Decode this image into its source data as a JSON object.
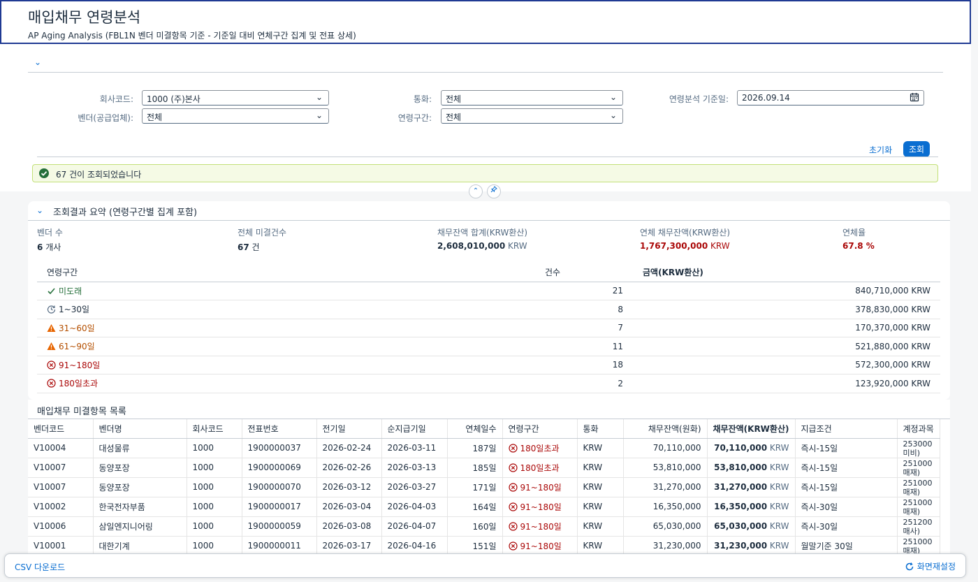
{
  "header": {
    "title": "매입채무 연령분석",
    "subtitle": "AP Aging Analysis (FBL1N 벤더 미결항목 기준 - 기준일 대비 연체구간 집계 및 전표 상세)"
  },
  "filters": {
    "company_label": "회사코드:",
    "company_value": "1000 (주)본사",
    "vendor_label": "벤더(공급업체):",
    "vendor_value": "전체",
    "currency_label": "통화:",
    "currency_value": "전체",
    "bucket_label": "연령구간:",
    "bucket_value": "전체",
    "date_label": "연령분석 기준일:",
    "date_value": "2026.09.14",
    "reset_label": "초기화",
    "search_label": "조회"
  },
  "message": "67 건이 조회되었습니다",
  "summary": {
    "title": "조회결과 요약 (연령구간별 집계 포함)",
    "kpis": {
      "vendor_count_label": "벤더 수",
      "vendor_count_value": "6",
      "vendor_count_unit": "개사",
      "open_items_label": "전체 미결건수",
      "open_items_value": "67",
      "open_items_unit": "건",
      "total_label": "채무잔액 합계(KRW환산)",
      "total_value": "2,608,010,000",
      "total_unit": "KRW",
      "overdue_label": "연체 채무잔액(KRW환산)",
      "overdue_value": "1,767,300,000",
      "overdue_unit": "KRW",
      "rate_label": "연체율",
      "rate_value": "67.8 %"
    },
    "columns": {
      "bucket": "연령구간",
      "count": "건수",
      "amount": "금액(KRW환산)"
    },
    "rows": [
      {
        "bucket": "미도래",
        "count": "21",
        "amount": "840,710,000 KRW",
        "state": "green"
      },
      {
        "bucket": "1~30일",
        "count": "8",
        "amount": "378,830,000 KRW",
        "state": "neutral"
      },
      {
        "bucket": "31~60일",
        "count": "7",
        "amount": "170,370,000 KRW",
        "state": "orange"
      },
      {
        "bucket": "61~90일",
        "count": "11",
        "amount": "521,880,000 KRW",
        "state": "orange"
      },
      {
        "bucket": "91~180일",
        "count": "18",
        "amount": "572,300,000 KRW",
        "state": "red"
      },
      {
        "bucket": "180일초과",
        "count": "2",
        "amount": "123,920,000 KRW",
        "state": "red"
      }
    ]
  },
  "items": {
    "title": "매입채무 미결항목 목록",
    "columns": [
      "벤더코드",
      "벤더명",
      "회사코드",
      "전표번호",
      "전기일",
      "순지급기일",
      "연체일수",
      "연령구간",
      "통화",
      "채무잔액(원화)",
      "채무잔액(KRW환산)",
      "지급조건",
      "계정과목"
    ],
    "rows": [
      {
        "vendor": "V10004",
        "name": "대성물류",
        "company": "1000",
        "doc": "1900000037",
        "post": "2026-02-24",
        "due": "2026-03-11",
        "days": "187일",
        "bucket": "180일초과",
        "cur": "KRW",
        "amt": "70,110,000",
        "amt_krw": "70,110,000",
        "unit": "KRW",
        "terms": "즉시-15일",
        "account": "253000 미비)"
      },
      {
        "vendor": "V10007",
        "name": "동양포장",
        "company": "1000",
        "doc": "1900000069",
        "post": "2026-02-26",
        "due": "2026-03-13",
        "days": "185일",
        "bucket": "180일초과",
        "cur": "KRW",
        "amt": "53,810,000",
        "amt_krw": "53,810,000",
        "unit": "KRW",
        "terms": "즉시-15일",
        "account": "251000 매재)"
      },
      {
        "vendor": "V10007",
        "name": "동양포장",
        "company": "1000",
        "doc": "1900000070",
        "post": "2026-03-12",
        "due": "2026-03-27",
        "days": "171일",
        "bucket": "91~180일",
        "cur": "KRW",
        "amt": "31,270,000",
        "amt_krw": "31,270,000",
        "unit": "KRW",
        "terms": "즉시-15일",
        "account": "251000 매재)"
      },
      {
        "vendor": "V10002",
        "name": "한국전자부품",
        "company": "1000",
        "doc": "1900000017",
        "post": "2026-03-04",
        "due": "2026-04-03",
        "days": "164일",
        "bucket": "91~180일",
        "cur": "KRW",
        "amt": "16,350,000",
        "amt_krw": "16,350,000",
        "unit": "KRW",
        "terms": "즉시-30일",
        "account": "251000 매재)"
      },
      {
        "vendor": "V10006",
        "name": "삼일엔지니어링",
        "company": "1000",
        "doc": "1900000059",
        "post": "2026-03-08",
        "due": "2026-04-07",
        "days": "160일",
        "bucket": "91~180일",
        "cur": "KRW",
        "amt": "65,030,000",
        "amt_krw": "65,030,000",
        "unit": "KRW",
        "terms": "즉시-30일",
        "account": "251200 매사)"
      },
      {
        "vendor": "V10001",
        "name": "대한기계",
        "company": "1000",
        "doc": "1900000011",
        "post": "2026-03-17",
        "due": "2026-04-16",
        "days": "151일",
        "bucket": "91~180일",
        "cur": "KRW",
        "amt": "31,230,000",
        "amt_krw": "31,230,000",
        "unit": "KRW",
        "terms": "월말기준 30일",
        "account": "251000 매재)"
      }
    ]
  },
  "footer": {
    "csv_label": "CSV 다운로드",
    "reset_label": "화면재설정"
  },
  "colors": {
    "accent": "#0a6ed1",
    "green": "#256f3a",
    "orange": "#b44f00",
    "red": "#aa0808"
  }
}
